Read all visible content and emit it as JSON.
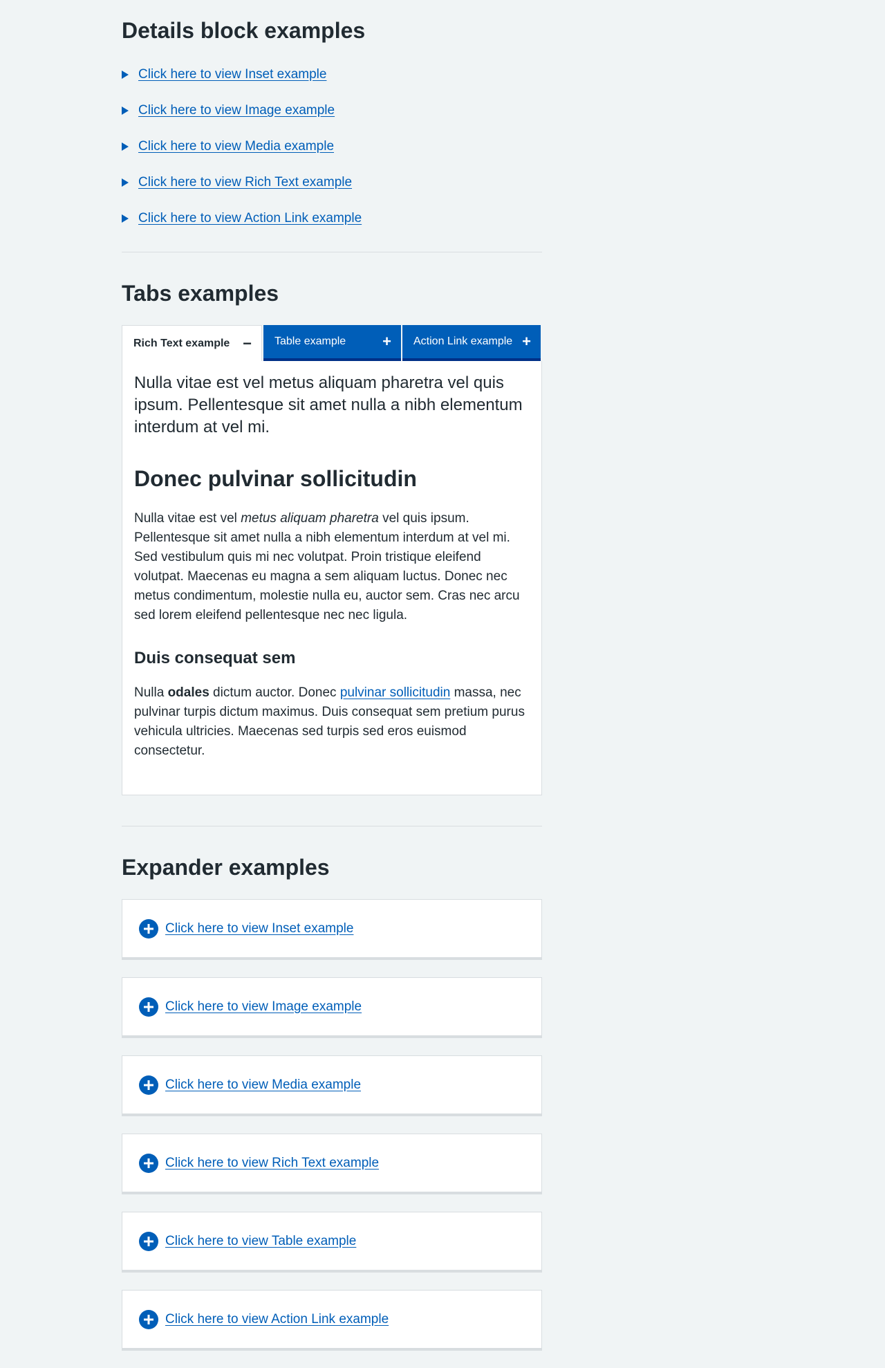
{
  "details": {
    "title": "Details block examples",
    "items": [
      {
        "label": "Click here to view Inset example"
      },
      {
        "label": "Click here to view Image example"
      },
      {
        "label": "Click here to view Media example"
      },
      {
        "label": "Click here to view Rich Text example"
      },
      {
        "label": "Click here to view Action Link example"
      }
    ]
  },
  "tabs": {
    "title": "Tabs examples",
    "items": [
      {
        "label": "Rich Text example",
        "icon": "minus-icon",
        "state": "active"
      },
      {
        "label": "Table example",
        "icon": "plus-icon",
        "state": "inactive"
      },
      {
        "label": "Action Link example",
        "icon": "plus-icon",
        "state": "inactive"
      }
    ],
    "panel": {
      "lede": "Nulla vitae est vel metus aliquam pharetra vel quis ipsum. Pellentesque sit amet nulla a nibh elementum interdum at vel mi.",
      "heading": "Donec pulvinar sollicitudin",
      "para1_start": "Nulla vitae est vel ",
      "para1_italic": "metus aliquam pharetra",
      "para1_end": " vel quis ipsum. Pellentesque sit amet nulla a nibh elementum interdum at vel mi. Sed vestibulum quis mi nec volutpat. Proin tristique eleifend volutpat. Maecenas eu magna a sem aliquam luctus. Donec nec metus condimentum, molestie nulla eu, auctor sem. Cras nec arcu sed lorem eleifend pellentesque nec nec ligula.",
      "subheading": "Duis consequat sem",
      "para2_start": "Nulla ",
      "para2_bold": "odales",
      "para2_mid": " dictum auctor. Donec ",
      "para2_link": "pulvinar sollicitudin",
      "para2_end": " massa, nec pulvinar turpis dictum maximus. Duis consequat sem pretium purus vehicula ultricies. Maecenas sed turpis sed eros euismod consectetur."
    }
  },
  "expander": {
    "title": "Expander examples",
    "items": [
      {
        "label": "Click here to view Inset example"
      },
      {
        "label": "Click here to view Image example"
      },
      {
        "label": "Click here to view Media example"
      },
      {
        "label": "Click here to view Rich Text example"
      },
      {
        "label": "Click here to view Table example"
      },
      {
        "label": "Click here to view Action Link example"
      }
    ]
  },
  "colors": {
    "link": "#005eb8",
    "tab_active_bg": "#ffffff",
    "tab_inactive_bg": "#005eb8",
    "page_bg": "#f0f4f5",
    "text": "#212b32"
  }
}
